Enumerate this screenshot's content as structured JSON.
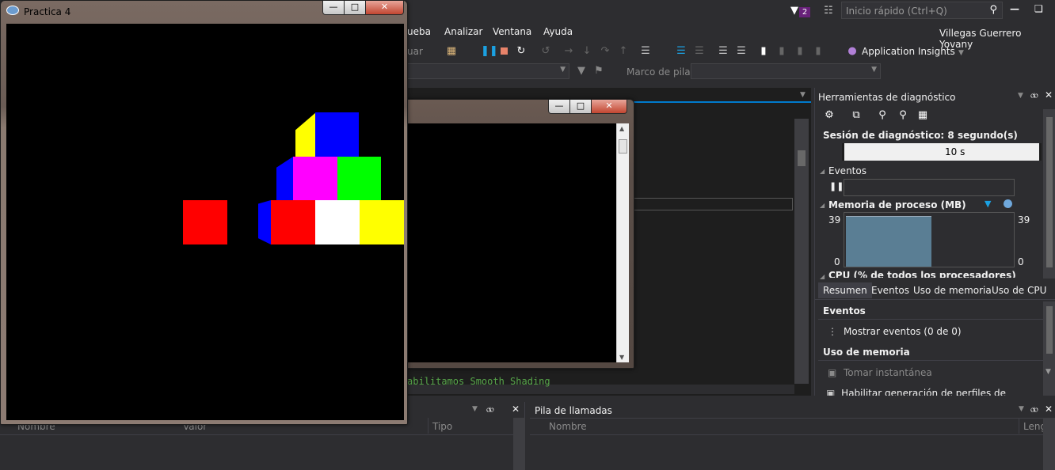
{
  "vs": {
    "filter_badge": "2",
    "quick_launch_placeholder": "Inicio rápido (Ctrl+Q)",
    "menu": [
      "ueba",
      "Analizar",
      "Ventana",
      "Ayuda"
    ],
    "user_name": "Villegas Guerrero Yovany",
    "continue_fragment": "uar",
    "app_insights_label": "Application Insights",
    "stack_frame_label": "Marco de pila:",
    "output_text": "abilitamos Smooth Shading"
  },
  "diagnostics": {
    "title": "Herramientas de diagnóstico",
    "session": "Sesión de diagnóstico: 8 segundo(s)",
    "timeline_mark": "10 s",
    "events_label": "Eventos",
    "memory_label": "Memoria de proceso (MB)",
    "memory_max_left": "39",
    "memory_min_left": "0",
    "memory_max_right": "39",
    "memory_min_right": "0",
    "memory_value": 39,
    "cpu_label": "CPU (% de todos los procesadores)",
    "tabs": [
      "Resumen",
      "Eventos",
      "Uso de memoria",
      "Uso de CPU"
    ],
    "section_events": "Eventos",
    "show_events": "Mostrar eventos (0 de 0)",
    "section_memory": "Uso de memoria",
    "snapshot": "Tomar instantánea",
    "heap_profiling": "Habilitar generación de perfiles de montón (a"
  },
  "locals_panel": {
    "columns": [
      "Nombre",
      "Valor",
      "Tipo"
    ]
  },
  "callstack_panel": {
    "title": "Pila de llamadas",
    "columns": [
      "Nombre",
      "Leng"
    ]
  },
  "glut_window": {
    "title": "Practica 4"
  },
  "console_window": {
    "title": ""
  },
  "colors": {
    "red": "#ff0000",
    "blue": "#0000ff",
    "yellow": "#ffff00",
    "magenta": "#ff00ff",
    "green": "#00ff00",
    "white": "#ffffff",
    "vs_bg": "#2d2d30",
    "accent": "#007acc"
  }
}
